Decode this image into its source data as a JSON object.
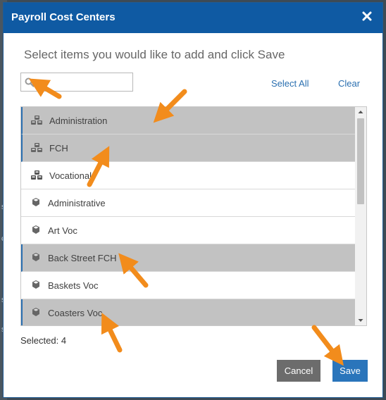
{
  "background": {
    "edge_letters": [
      "s",
      "c",
      "s",
      "ss"
    ]
  },
  "dialog": {
    "title": "Payroll Cost Centers",
    "close_icon": "close-icon",
    "prompt": "Select items you would like to add and click Save",
    "search": {
      "value": "",
      "placeholder": "",
      "icon": "search-icon"
    },
    "select_all_label": "Select All",
    "clear_label": "Clear",
    "items": [
      {
        "label": "Administration",
        "icon": "group-cubes-icon",
        "selected": true
      },
      {
        "label": "FCH",
        "icon": "group-cubes-icon",
        "selected": true
      },
      {
        "label": "Vocational",
        "icon": "group-cubes-icon",
        "selected": false
      },
      {
        "label": "Administrative",
        "icon": "cube-icon",
        "selected": false
      },
      {
        "label": "Art Voc",
        "icon": "cube-icon",
        "selected": false
      },
      {
        "label": "Back Street FCH",
        "icon": "cube-icon",
        "selected": true
      },
      {
        "label": "Baskets Voc",
        "icon": "cube-icon",
        "selected": false
      },
      {
        "label": "Coasters Voc",
        "icon": "cube-icon",
        "selected": true
      }
    ],
    "selected_count_text": "Selected: 4",
    "cancel_label": "Cancel",
    "save_label": "Save"
  },
  "colors": {
    "header": "#0f5aa3",
    "selected_row": "#c2c2c2",
    "accent": "#2a75bb",
    "annotation_arrow": "#f28c1c"
  }
}
